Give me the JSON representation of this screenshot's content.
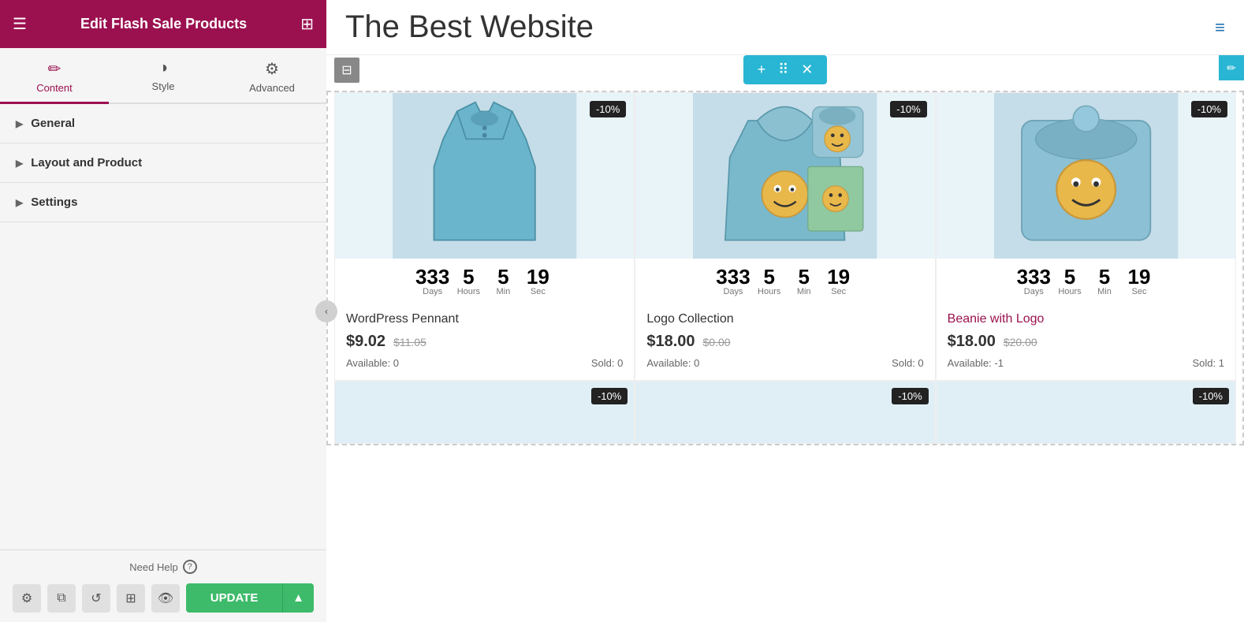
{
  "sidebar": {
    "title": "Edit Flash Sale Products",
    "hamburger": "☰",
    "grid": "⊞",
    "tabs": [
      {
        "label": "Content",
        "icon": "✏️",
        "active": true
      },
      {
        "label": "Style",
        "icon": "◑",
        "active": false
      },
      {
        "label": "Advanced",
        "icon": "⚙",
        "active": false
      }
    ],
    "accordion": [
      {
        "label": "General"
      },
      {
        "label": "Layout and Product"
      },
      {
        "label": "Settings"
      }
    ],
    "need_help": "Need Help",
    "update_btn": "UPDATE",
    "bottom_icons": [
      "⚙",
      "⧉",
      "↺",
      "⊞",
      "👁"
    ]
  },
  "main": {
    "site_title": "The Best Website",
    "menu_icon": "≡",
    "widget_bar": {
      "add": "+",
      "move": "⠿",
      "close": "✕"
    },
    "products": [
      {
        "id": 1,
        "name": "WordPress Pennant",
        "discount": "-10%",
        "countdown": {
          "days": "333",
          "hours": "5",
          "min": "5",
          "sec": "19"
        },
        "price_current": "$9.02",
        "price_original": "$11.05",
        "available": "Available: 0",
        "sold": "Sold: 0",
        "image_color": "#b8d8e8"
      },
      {
        "id": 2,
        "name": "Logo Collection",
        "discount": "-10%",
        "countdown": {
          "days": "333",
          "hours": "5",
          "min": "5",
          "sec": "19"
        },
        "price_current": "$18.00",
        "price_original": "$0.00",
        "available": "Available: 0",
        "sold": "Sold: 0",
        "image_color": "#b8d8e8"
      },
      {
        "id": 3,
        "name": "Beanie with Logo",
        "discount": "-10%",
        "countdown": {
          "days": "333",
          "hours": "5",
          "min": "5",
          "sec": "19"
        },
        "price_current": "$18.00",
        "price_original": "$20.00",
        "available": "Available: -1",
        "sold": "Sold: 1",
        "image_color": "#b8d8e8"
      }
    ],
    "partial_discounts": [
      "-10%",
      "-10%",
      "-10%"
    ]
  }
}
